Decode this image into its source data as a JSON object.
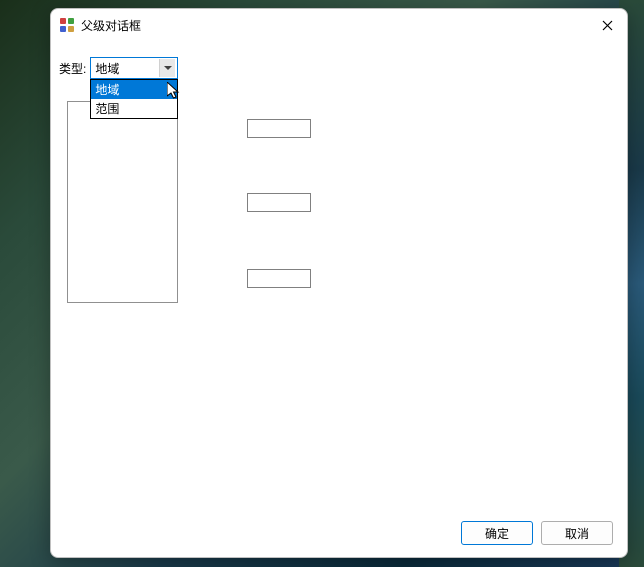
{
  "dialog": {
    "title": "父级对话框"
  },
  "form": {
    "type_label": "类型:",
    "combobox": {
      "selected": "地域",
      "options": [
        "地域",
        "范围"
      ]
    }
  },
  "buttons": {
    "ok": "确定",
    "cancel": "取消"
  }
}
